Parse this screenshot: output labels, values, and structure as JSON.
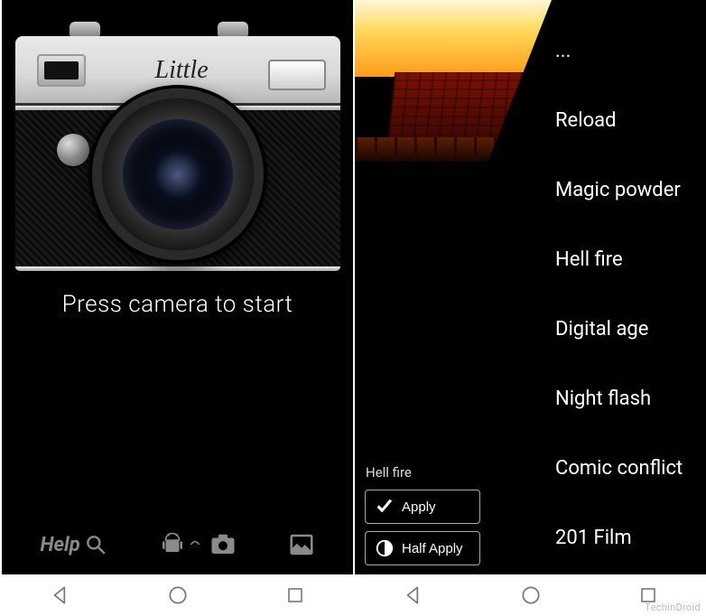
{
  "left": {
    "camera_brand": "Little",
    "start_text": "Press camera to start",
    "toolbar": {
      "help_label": "Help"
    }
  },
  "right": {
    "current_filter_label": "Hell fire",
    "apply_label": "Apply",
    "half_apply_label": "Half Apply",
    "filters": [
      "...",
      "Reload",
      "Magic powder",
      "Hell fire",
      "Digital age",
      "Night flash",
      "Comic conflict",
      "201 Film"
    ]
  },
  "watermark": "TechinDroid"
}
